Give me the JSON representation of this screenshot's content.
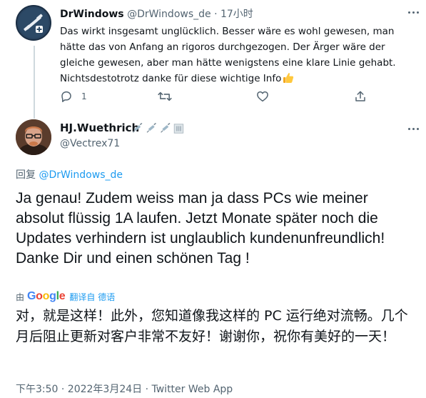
{
  "parent_tweet": {
    "display_name": "DrWindows",
    "handle": "@DrWindows_de",
    "separator": "·",
    "time_ago": "17小时",
    "text": "Das wirkt insgesamt unglücklich. Besser wäre es wohl gewesen, man hätte das von Anfang an rigoros durchgezogen. Der Ärger wäre der gleiche gewesen, aber man hätte wenigstens eine klare Linie gehabt. Nichtsdestotrotz danke für diese wichtige Info",
    "emoji": "thumbs-up",
    "reply_count": "1",
    "avatar": "drwindows-logo",
    "icons": [
      "reply-icon",
      "retweet-icon",
      "like-icon",
      "share-icon",
      "more-icon"
    ]
  },
  "reply_tweet": {
    "display_name": "HJ.Wuethrich",
    "name_emojis": [
      "syringe",
      "syringe",
      "syringe",
      "bank"
    ],
    "handle": "@Vectrex71",
    "replying_prefix": "回复",
    "replying_to": "@DrWindows_de",
    "text": "Ja genau! Zudem weiss man ja dass PCs wie meiner absolut flüssig 1A laufen. Jetzt Monate später noch die Updates verhindern ist unglaublich kundenunfreundlich! Danke Dir und einen schönen Tag !",
    "translate_by": "由",
    "translate_provider": "Google",
    "translate_action": "翻译自 德语",
    "translated_text": "对，就是这样！此外，您知道像我这样的 PC 运行绝对流畅。几个月后阻止更新对客户非常不友好！谢谢你，祝你有美好的一天！",
    "meta": "下午3:50 · 2022年3月24日 · Twitter Web App"
  },
  "colors": {
    "link": "#1d9bf0",
    "muted": "#536471",
    "text": "#0f1419",
    "google_blue": "#4285f4",
    "google_red": "#ea4335",
    "google_yellow": "#fbbc05",
    "google_green": "#34a853"
  }
}
